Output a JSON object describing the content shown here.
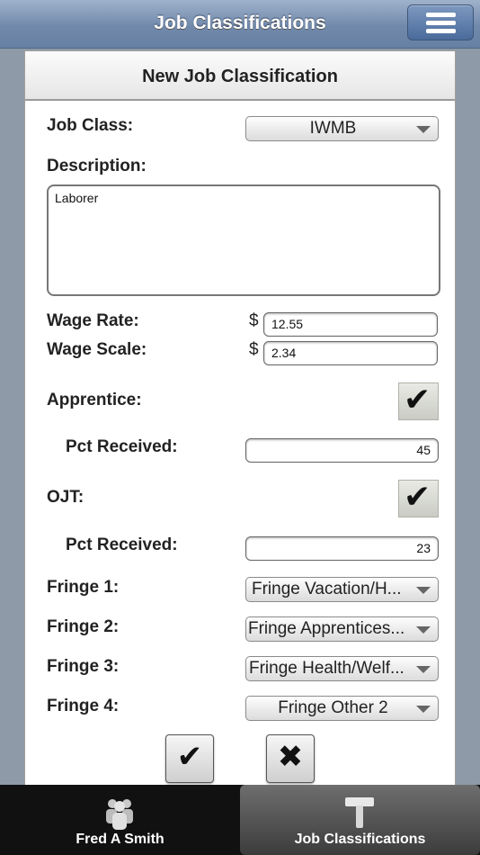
{
  "header": {
    "title": "Job Classifications",
    "menu_icon": "hamburger-menu-icon"
  },
  "form": {
    "title": "New Job Classification",
    "job_class": {
      "label": "Job Class:",
      "value": "IWMB"
    },
    "description": {
      "label": "Description:",
      "value": "Laborer"
    },
    "wage_rate": {
      "label": "Wage Rate:",
      "currency": "$",
      "value": "12.55"
    },
    "wage_scale": {
      "label": "Wage Scale:",
      "currency": "$",
      "value": "2.34"
    },
    "apprentice": {
      "label": "Apprentice:",
      "checked": true,
      "pct_label": "Pct Received:",
      "pct_value": "45"
    },
    "ojt": {
      "label": "OJT:",
      "checked": true,
      "pct_label": "Pct Received:",
      "pct_value": "23"
    },
    "fringes": [
      {
        "label": "Fringe 1:",
        "value": "Fringe Vacation/H..."
      },
      {
        "label": "Fringe 2:",
        "value": "Fringe Apprentices..."
      },
      {
        "label": "Fringe 3:",
        "value": "Fringe Health/Welf..."
      },
      {
        "label": "Fringe 4:",
        "value": "Fringe Other 2"
      }
    ],
    "actions": {
      "confirm_icon": "checkmark-icon",
      "cancel_icon": "close-icon"
    }
  },
  "tabbar": {
    "tabs": [
      {
        "label": "Fred A Smith",
        "icon": "people-icon",
        "active": false
      },
      {
        "label": "Job Classifications",
        "icon": "hammer-icon",
        "active": true
      }
    ]
  }
}
